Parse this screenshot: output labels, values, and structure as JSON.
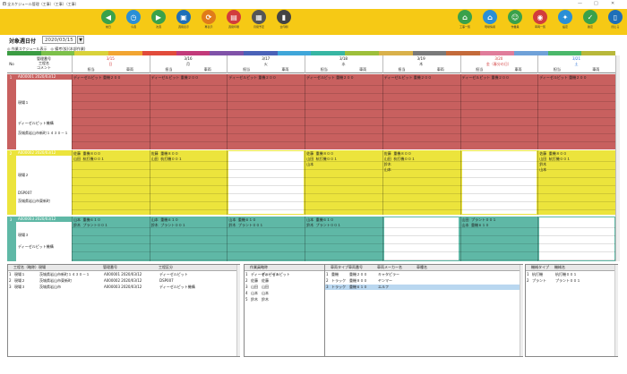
{
  "window": {
    "title": "🗖 全スケジュール管理（工事）（工事）（工事）",
    "min": "—",
    "max": "□",
    "close": "✕"
  },
  "toolbar": {
    "left": [
      {
        "label": "前日",
        "icon": "arrow-left-icon",
        "color": "#3aa14a"
      },
      {
        "label": "今週",
        "icon": "clock-icon",
        "color": "#2a8fd6"
      },
      {
        "label": "次週",
        "icon": "arrow-right-icon",
        "color": "#3aa14a"
      },
      {
        "label": "週間表示",
        "icon": "truck-icon",
        "color": "#1e6fb8"
      },
      {
        "label": "再表示",
        "icon": "refresh-icon",
        "color": "#e07b1a"
      },
      {
        "label": "週間印刷",
        "icon": "print-icon",
        "color": "#d23c3c"
      },
      {
        "label": "月間予定",
        "icon": "calendar-icon",
        "color": "#555"
      },
      {
        "label": "全印刷",
        "icon": "book-icon",
        "color": "#444"
      }
    ],
    "right": [
      {
        "label": "工事一覧",
        "icon": "house-icon",
        "color": "#3aa14a"
      },
      {
        "label": "現場情報",
        "icon": "home-icon",
        "color": "#2a8fd6"
      },
      {
        "label": "作業員",
        "icon": "worker-icon",
        "color": "#3aa14a"
      },
      {
        "label": "車両一覧",
        "icon": "car-icon",
        "color": "#d23c3c"
      },
      {
        "label": "設定",
        "icon": "wrench-icon",
        "color": "#2a8fd6"
      },
      {
        "label": "確定",
        "icon": "check-icon",
        "color": "#3aa14a"
      },
      {
        "label": "閉じる",
        "icon": "door-icon",
        "color": "#1e6fb8"
      }
    ]
  },
  "date": {
    "label": "対象週日付",
    "value": "2020/03/15",
    "cal": "▼"
  },
  "options": "◎ 作業スケジュール表示　◎ 備考(仮)(本部作業)",
  "colors": [
    "#3b9c43",
    "#7cc04a",
    "#d9d23a",
    "#f2a531",
    "#e14b3b",
    "#c23a7a",
    "#8052a8",
    "#4a62b8",
    "#3fa6d9",
    "#37b6a3",
    "#9dbf3a",
    "#d9b14a",
    "#7a7a7a",
    "#c46a3a",
    "#e07c9a",
    "#6fa1d8",
    "#4ab86a",
    "#b8b83a"
  ],
  "grid": {
    "rowhead": [
      "管理番号",
      "工程名",
      "コメント"
    ],
    "no": "No",
    "days": [
      {
        "date": "3/15",
        "dow": "日",
        "sub": [
          "担当",
          "車両"
        ]
      },
      {
        "date": "3/16",
        "dow": "月",
        "sub": [
          "担当",
          "車両"
        ]
      },
      {
        "date": "3/17",
        "dow": "火",
        "sub": [
          "担当",
          "車両"
        ]
      },
      {
        "date": "3/18",
        "dow": "水",
        "sub": [
          "担当",
          "車両"
        ]
      },
      {
        "date": "3/19",
        "dow": "木",
        "sub": [
          "担当",
          "車両"
        ]
      },
      {
        "date": "3/20",
        "dow": "金（春分の日）",
        "sub": [
          "担当",
          "車両"
        ]
      },
      {
        "date": "3/21",
        "dow": "土",
        "sub": [
          "担当",
          "車両"
        ]
      }
    ],
    "rows": [
      {
        "no": "1",
        "id": "A000001 2020/03/12",
        "name": "現場１",
        "memo": "ディーゼルピット機構",
        "addr": "茨城県岩山市新町１４３０－１",
        "color": "#c8605f",
        "cells": [
          "ディーゼルピット 重機２００",
          "ディーゼルピット 重機２００",
          "ディーゼルピット 重機２００",
          "ディーゼルピット 重機２００",
          "ディーゼルピット 重機２００",
          "ディーゼルピット 重機２００",
          "ディーゼルピット 重機２００"
        ]
      },
      {
        "no": "2",
        "id": "A000002 2020/03/12",
        "name": "現場２",
        "memo": "DSP007",
        "addr": "茨城県岩山市東新町",
        "color": "#ece43c",
        "cells": [
          "佐藤  重機８００\n山田  杭打機００１",
          "佐藤  重機８００\n山田  杭打機００１",
          "",
          "佐藤  重機８００\n山田  杭打機００１\n山本",
          "佐藤  重機８００\n山田  杭打機００１\n鈴木\n山本",
          "",
          "佐藤  重機８００\n山田  杭打機００１\n鈴木\n山本"
        ]
      },
      {
        "no": "3",
        "id": "A000003 2020/03/12",
        "name": "現場３",
        "memo": "ディーゼルピット機構",
        "addr": "",
        "color": "#5fb8a6",
        "cells": [
          "山本  重機６１０\n鈴木  プラント００１",
          "山本  重機６１０\n鈴木  プラント００１",
          "山本  重機６１０\n鈴木  プラント００１",
          "山本  重機６１０\n鈴木  プラント００１",
          "",
          "山田  プラント００１\n山本  重機６１０",
          ""
        ]
      }
    ]
  },
  "panels": {
    "p1": {
      "cols": [
        "工程名（略称）",
        "現場",
        "管理番号",
        "工程区分"
      ],
      "rows": [
        [
          "1",
          "現場１",
          "茨城県岩山市新町１４３０－１",
          "A000001 2020/03/12",
          "ディーゼルピット"
        ],
        [
          "2",
          "現場２",
          "茨城県岩山市東新町",
          "A000002 2020/03/12",
          "DSP007"
        ],
        [
          "3",
          "現場３",
          "茨城県岩山市",
          "A000003 2020/03/12",
          "ディーゼルピット機構"
        ]
      ]
    },
    "p2": {
      "cols": [
        "作業員",
        "略称"
      ],
      "rows": [
        [
          "1",
          "ディーゼルピット",
          "ディーゼルピット"
        ],
        [
          "2",
          "佐藤",
          "佐藤"
        ],
        [
          "3",
          "山田",
          "山田"
        ],
        [
          "4",
          "山本",
          "山本"
        ],
        [
          "5",
          "鈴木",
          "鈴木"
        ]
      ]
    },
    "p3": {
      "cols": [
        "車両タイプ",
        "車両番号",
        "車両メーカー名",
        "車種名"
      ],
      "rows": [
        [
          "1",
          "重機",
          "重機２００",
          "キャタピラー"
        ],
        [
          "2",
          "トラック",
          "重機８００",
          "ヤンマー"
        ],
        [
          "3",
          "トラック",
          "重機６１０",
          "エルフ"
        ]
      ]
    },
    "p4": {
      "cols": [
        "機械タイプ",
        "機械名"
      ],
      "rows": [
        [
          "1",
          "杭打機",
          "杭打機００１"
        ],
        [
          "2",
          "プラント",
          "プラント００１"
        ]
      ]
    }
  }
}
